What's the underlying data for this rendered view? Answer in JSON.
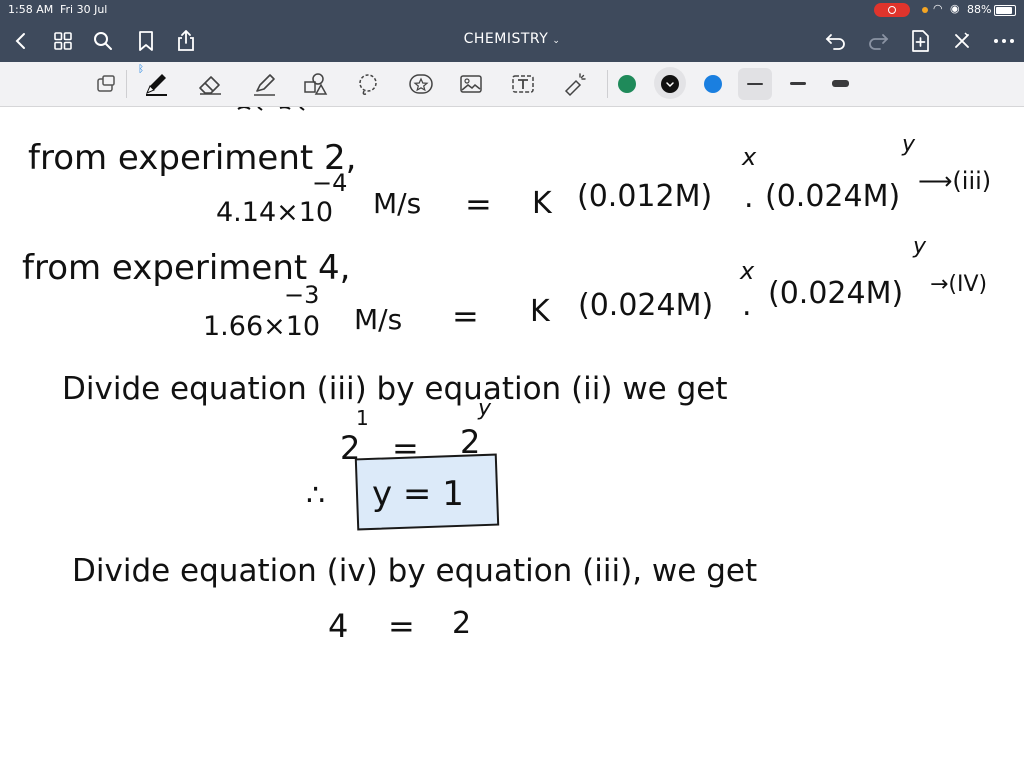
{
  "status": {
    "time": "1:58 AM",
    "date": "Fri 30 Jul",
    "battery": "88%"
  },
  "nav": {
    "title": "CHEMISTRY",
    "icons": [
      "back-chevron-icon",
      "grid-icon",
      "search-icon",
      "bookmark-icon",
      "share-icon",
      "undo-icon",
      "redo-icon",
      "add-page-icon",
      "close-icon",
      "more-icon"
    ]
  },
  "toolbar": {
    "tools": [
      "lasso-select-icon",
      "pen-icon",
      "eraser-icon",
      "highlighter-icon",
      "shapes-icon",
      "lasso-icon",
      "sticker-icon",
      "image-icon",
      "text-icon",
      "laser-pointer-icon"
    ],
    "colors": [
      "#1f8a5a",
      "#111111",
      "#1a7fe0"
    ],
    "selected_color": "#111111"
  },
  "notes": {
    "l1_a": "from experiment 2,",
    "l2_lhs": "4.14×10",
    "l2_exp": "−4",
    "l2_unit": "M/s",
    "l2_eq": "=",
    "l2_k": "K",
    "l2_t1": "(0.012M)",
    "l2_x": "x",
    "l2_dot": ".",
    "l2_t2": "(0.024M)",
    "l2_y": "y",
    "l2_tag": "⟶(iii)",
    "l3_a": "from experiment 4,",
    "l4_lhs": "1.66×10",
    "l4_exp": "−3",
    "l4_unit": "M/s",
    "l4_eq": "=",
    "l4_k": "K",
    "l4_t1": "(0.024M)",
    "l4_x": "x",
    "l4_dot": ".",
    "l4_t2": "(0.024M)",
    "l4_y": "y",
    "l4_tag": "→(IV)",
    "l5": "Divide equation (iii) by equation (ii) we get",
    "l6_a": "2",
    "l6_e1": "1",
    "l6_eq": "=",
    "l6_b": "2",
    "l6_e2": "y",
    "l7_therefore": "∴",
    "l7_boxed": "y = 1",
    "l8": "Divide equation (iv) by equation (iii), we get",
    "l9_a": "4",
    "l9_eq": "=",
    "l9_b": "2"
  }
}
